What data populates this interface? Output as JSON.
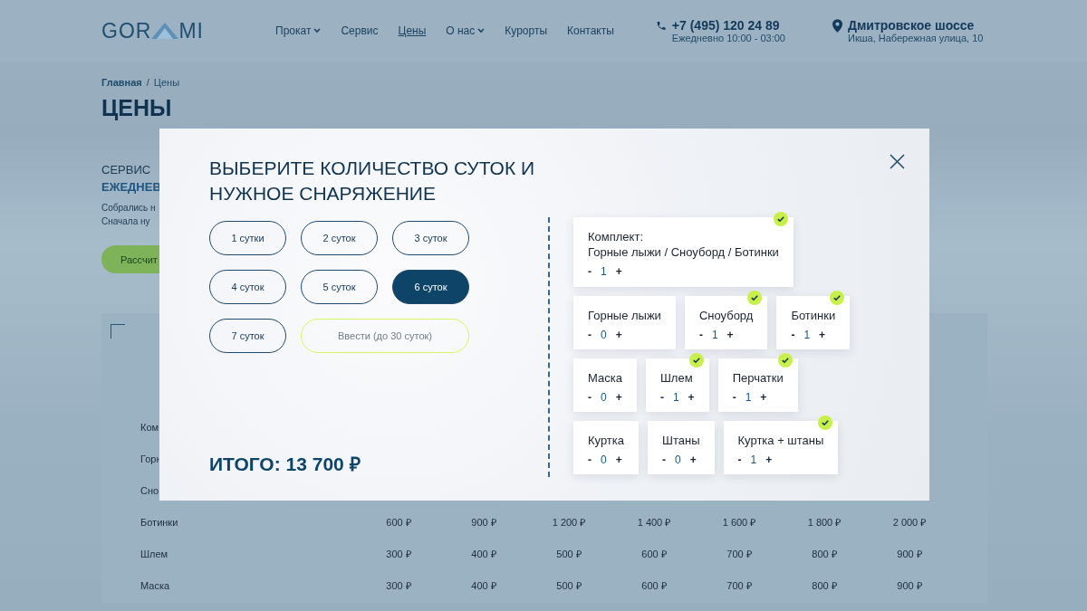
{
  "header": {
    "logo": {
      "left": "GOR",
      "right": "MI"
    },
    "nav": [
      {
        "label": "Прокат",
        "dropdown": true,
        "selected": false
      },
      {
        "label": "Сервис",
        "dropdown": false,
        "selected": false
      },
      {
        "label": "Цены",
        "dropdown": false,
        "selected": true
      },
      {
        "label": "О нас",
        "dropdown": true,
        "selected": false
      },
      {
        "label": "Курорты",
        "dropdown": false,
        "selected": false
      },
      {
        "label": "Контакты",
        "dropdown": false,
        "selected": false
      }
    ],
    "phone": {
      "number": "+7 (495) 120 24 89",
      "hours": "Ежедневно 10:00 - 03:00"
    },
    "address": {
      "street": "Дмитровское шоссе",
      "city": "Икша, Набережная улица, 10"
    }
  },
  "breadcrumb": {
    "items": [
      {
        "label": "Главная",
        "selected": false
      },
      {
        "label": "Цены",
        "selected": true
      }
    ],
    "separator": "/"
  },
  "page_title": "ЦЕНЫ",
  "intro": {
    "heading_1": "СЕРВИС",
    "heading_2": "ЕЖЕДНЕВ",
    "text_1": "Собрались н",
    "text_2": "Сначала ну",
    "button": "Рассчит"
  },
  "price_table": {
    "rows": [
      {
        "label": "Ком"
      },
      {
        "label": "Горн"
      },
      {
        "label": "Сно"
      },
      {
        "label": "Ботинки",
        "prices": [
          "600 ₽",
          "900 ₽",
          "1 200 ₽",
          "1 400 ₽",
          "1 600 ₽",
          "1 800 ₽",
          "2 000 ₽"
        ]
      },
      {
        "label": "Шлем",
        "prices": [
          "300 ₽",
          "400 ₽",
          "500 ₽",
          "600 ₽",
          "700 ₽",
          "800 ₽",
          "900 ₽"
        ]
      },
      {
        "label": "Маска",
        "prices": [
          "300 ₽",
          "400 ₽",
          "500 ₽",
          "600 ₽",
          "700 ₽",
          "800 ₽",
          "900 ₽"
        ]
      }
    ]
  },
  "modal": {
    "title": "ВЫБЕРИТЕ КОЛИЧЕСТВО СУТОК И\nНУЖНОЕ СНАРЯЖЕНИЕ",
    "days": [
      {
        "label": "1 сутки",
        "selected": false
      },
      {
        "label": "2 суток",
        "selected": false
      },
      {
        "label": "3 суток",
        "selected": false
      },
      {
        "label": "4 суток",
        "selected": false
      },
      {
        "label": "5 суток",
        "selected": false
      },
      {
        "label": "6 суток",
        "selected": true
      },
      {
        "label": "7 суток",
        "selected": false
      }
    ],
    "custom_days": {
      "placeholder": "Ввести (до 30 суток)"
    },
    "total": "ИТОГО: 13 700 ₽",
    "equipment_rows": [
      {
        "items": [
          {
            "label": "Комплект:\nГорные лыжи / Сноуборд / Ботинки",
            "quantity": "1",
            "decrement": "-",
            "increment": "+",
            "checked": true
          }
        ]
      },
      {
        "items": [
          {
            "label": "Горные лыжи",
            "quantity": "0",
            "decrement": "-",
            "increment": "+",
            "checked": false
          },
          {
            "label": "Сноуборд",
            "quantity": "1",
            "decrement": "-",
            "increment": "+",
            "checked": true
          },
          {
            "label": "Ботинки",
            "quantity": "1",
            "decrement": "-",
            "increment": "+",
            "checked": true
          }
        ]
      },
      {
        "items": [
          {
            "label": "Маска",
            "quantity": "0",
            "decrement": "-",
            "increment": "+",
            "checked": false
          },
          {
            "label": "Шлем",
            "quantity": "1",
            "decrement": "-",
            "increment": "+",
            "checked": true
          },
          {
            "label": "Перчатки",
            "quantity": "1",
            "decrement": "-",
            "increment": "+",
            "checked": true
          }
        ]
      },
      {
        "items": [
          {
            "label": "Куртка",
            "quantity": "0",
            "decrement": "-",
            "increment": "+",
            "checked": false
          },
          {
            "label": "Штаны",
            "quantity": "0",
            "decrement": "-",
            "increment": "+",
            "checked": false
          },
          {
            "label": "Куртка + штаны",
            "quantity": "1",
            "decrement": "-",
            "increment": "+",
            "checked": true
          }
        ]
      }
    ]
  }
}
